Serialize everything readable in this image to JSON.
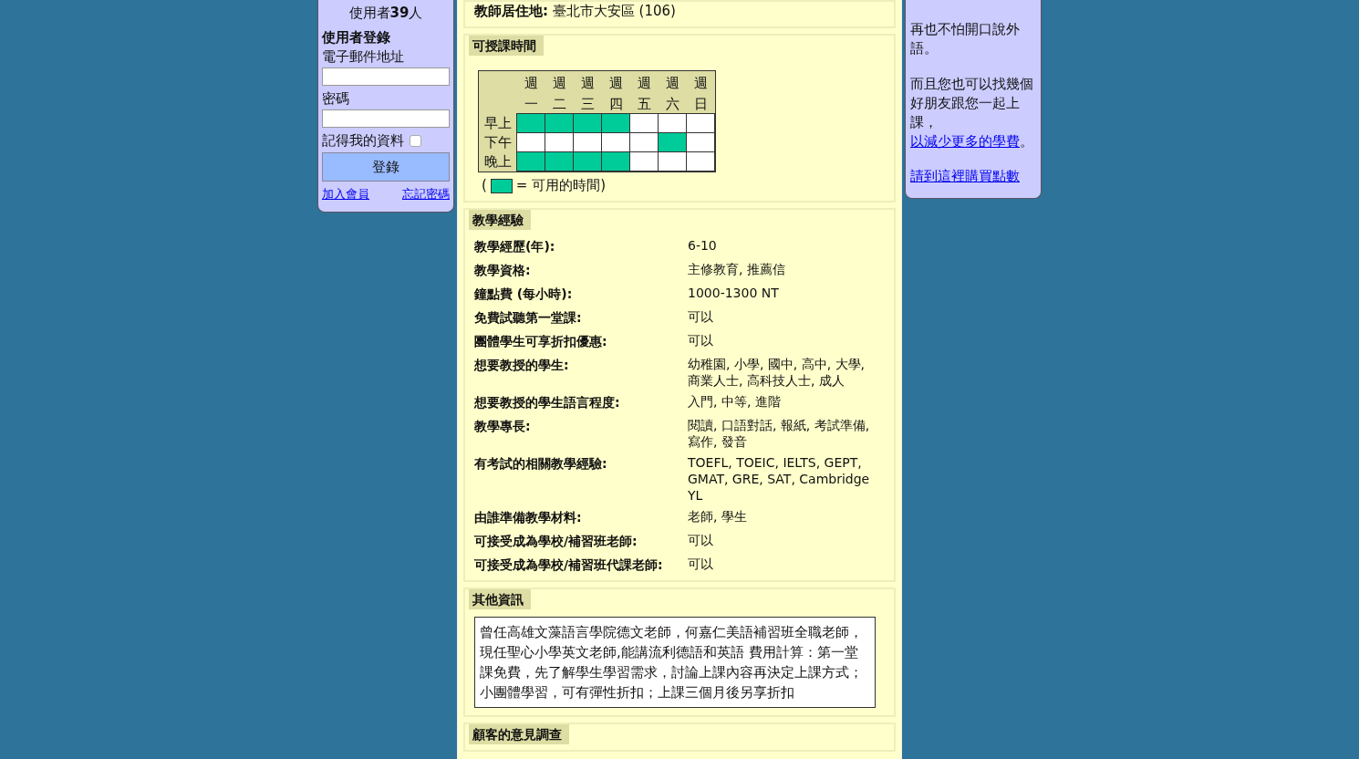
{
  "left_panel": {
    "online_prefix": "使用者",
    "online_count": "39",
    "online_suffix": "人",
    "login_title": "使用者登錄",
    "email_label": "電子郵件地址",
    "password_label": "密碼",
    "remember_label": "記得我的資料",
    "remember_checked": false,
    "login_button": "登錄",
    "join_link": "加入會員",
    "forgot_link": "忘記密碼"
  },
  "location": {
    "label": "教師居住地:",
    "value": "臺北市大安區 (106)"
  },
  "schedule": {
    "title": "可授課時間",
    "days": [
      "週一",
      "週二",
      "週三",
      "週四",
      "週五",
      "週六",
      "週日"
    ],
    "rows": [
      {
        "label": "早上",
        "slots": [
          true,
          true,
          true,
          true,
          false,
          false,
          false
        ]
      },
      {
        "label": "下午",
        "slots": [
          false,
          false,
          false,
          false,
          false,
          true,
          false
        ]
      },
      {
        "label": "晚上",
        "slots": [
          true,
          true,
          true,
          true,
          false,
          false,
          false
        ]
      }
    ],
    "legend_open": "(",
    "legend_text": "= 可用的時間)"
  },
  "experience": {
    "title": "教學經驗",
    "rows": [
      {
        "label": "教學經歷(年):",
        "value": "6-10"
      },
      {
        "label": "教學資格:",
        "value": "主修教育, 推薦信"
      },
      {
        "label": "鐘點費 (每小時):",
        "value": "1000-1300 NT"
      },
      {
        "label": "免費試聽第一堂課:",
        "value": "可以"
      },
      {
        "label": "團體學生可享折扣優惠:",
        "value": "可以"
      },
      {
        "label": "想要教授的學生:",
        "value": "幼稚園, 小學, 國中, 高中, 大學, 商業人士, 高科技人士, 成人"
      },
      {
        "label": "想要教授的學生語言程度:",
        "value": "入門, 中等, 進階"
      },
      {
        "label": "教學專長:",
        "value": "閱讀, 口語對話, 報紙, 考試準備, 寫作, 發音"
      },
      {
        "label": "有考試的相關教學經驗:",
        "value": "TOEFL, TOEIC, IELTS, GEPT, GMAT, GRE, SAT, Cambridge YL"
      },
      {
        "label": "由誰準備教學材料:",
        "value": "老師, 學生"
      },
      {
        "label": "可接受成為學校/補習班老師:",
        "value": "可以"
      },
      {
        "label": "可接受成為學校/補習班代課老師:",
        "value": "可以"
      }
    ]
  },
  "other_info": {
    "title": "其他資訊",
    "text": "曾任高雄文藻語言學院德文老師，何嘉仁美語補習班全職老師，現任聖心小學英文老師,能講流利德語和英語 費用計算：第一堂課免費，先了解學生學習需求，討論上課內容再決定上課方式；小團體學習，可有彈性折扣；上課三個月後另享折扣"
  },
  "survey": {
    "title": "顧客的意見調查"
  },
  "right_panel": {
    "paragraph_1": "再也不怕開口說外語。",
    "paragraph_2_before": "而且您也可以找幾個好朋友跟您一起上課，",
    "paragraph_2_link": "以減少更多的學費",
    "paragraph_2_after": "。",
    "buy_link": "請到這裡購買點數"
  }
}
